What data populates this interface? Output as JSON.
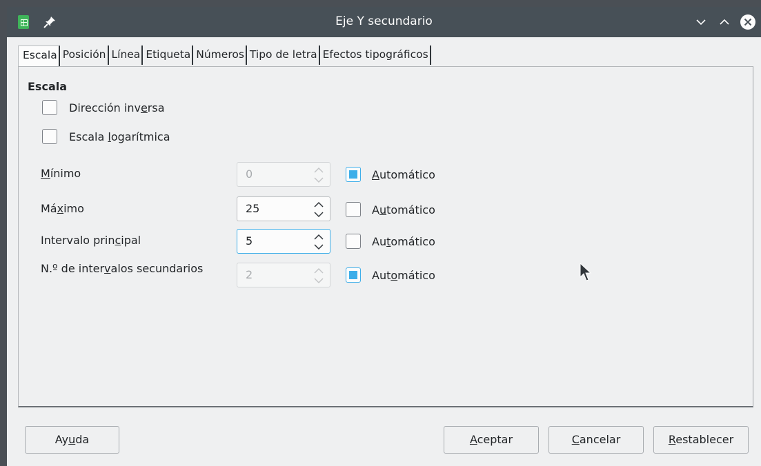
{
  "window": {
    "title": "Eje Y secundario",
    "app_icon": "calc-spreadsheet-icon",
    "controls": [
      "pin-icon",
      "chevron-down-icon",
      "chevron-up-icon",
      "close-icon"
    ]
  },
  "tabs": [
    {
      "label": "Escala",
      "active": true
    },
    {
      "label": "Posición",
      "active": false
    },
    {
      "label": "Línea",
      "active": false
    },
    {
      "label": "Etiqueta",
      "active": false
    },
    {
      "label": "Números",
      "active": false
    },
    {
      "label": "Tipo de letra",
      "active": false
    },
    {
      "label": "Efectos tipográficos",
      "active": false
    }
  ],
  "scale": {
    "section_title": "Escala",
    "reverse_direction": {
      "label_pre": "Dirección inv",
      "label_u": "e",
      "label_post": "rsa",
      "checked": false
    },
    "log_scale": {
      "label_pre": "Escala ",
      "label_u": "l",
      "label_post": "ogarítmica",
      "checked": false
    },
    "minimum": {
      "label_pre": "",
      "label_u": "M",
      "label_post": "ínimo",
      "value": "0",
      "disabled": true,
      "auto": {
        "label_pre": "",
        "label_u": "A",
        "label_post": "utomático",
        "checked": true
      }
    },
    "maximum": {
      "label_pre": "Má",
      "label_u": "x",
      "label_post": "imo",
      "value": "25",
      "disabled": false,
      "auto": {
        "label_pre": "A",
        "label_u": "u",
        "label_post": "tomático",
        "checked": false
      }
    },
    "major_interval": {
      "label_pre": "Intervalo prin",
      "label_u": "c",
      "label_post": "ipal",
      "value": "5",
      "disabled": false,
      "focused": true,
      "auto": {
        "label_pre": "Au",
        "label_u": "t",
        "label_post": "omático",
        "checked": false
      }
    },
    "minor_intervals": {
      "label_pre": "N.º de inter",
      "label_u": "v",
      "label_post": "alos secundarios",
      "value": "2",
      "disabled": true,
      "auto": {
        "label_pre": "Aut",
        "label_u": "o",
        "label_post": "mático",
        "checked": true
      }
    }
  },
  "buttons": {
    "help": {
      "pre": "Ay",
      "u": "u",
      "post": "da"
    },
    "ok": {
      "pre": "",
      "u": "A",
      "post": "ceptar"
    },
    "cancel": {
      "pre": "",
      "u": "C",
      "post": "ancelar"
    },
    "reset": {
      "pre": "",
      "u": "R",
      "post": "establecer"
    }
  },
  "colors": {
    "titlebar": "#475057",
    "accent": "#3daee9",
    "background": "#eff0f1"
  }
}
